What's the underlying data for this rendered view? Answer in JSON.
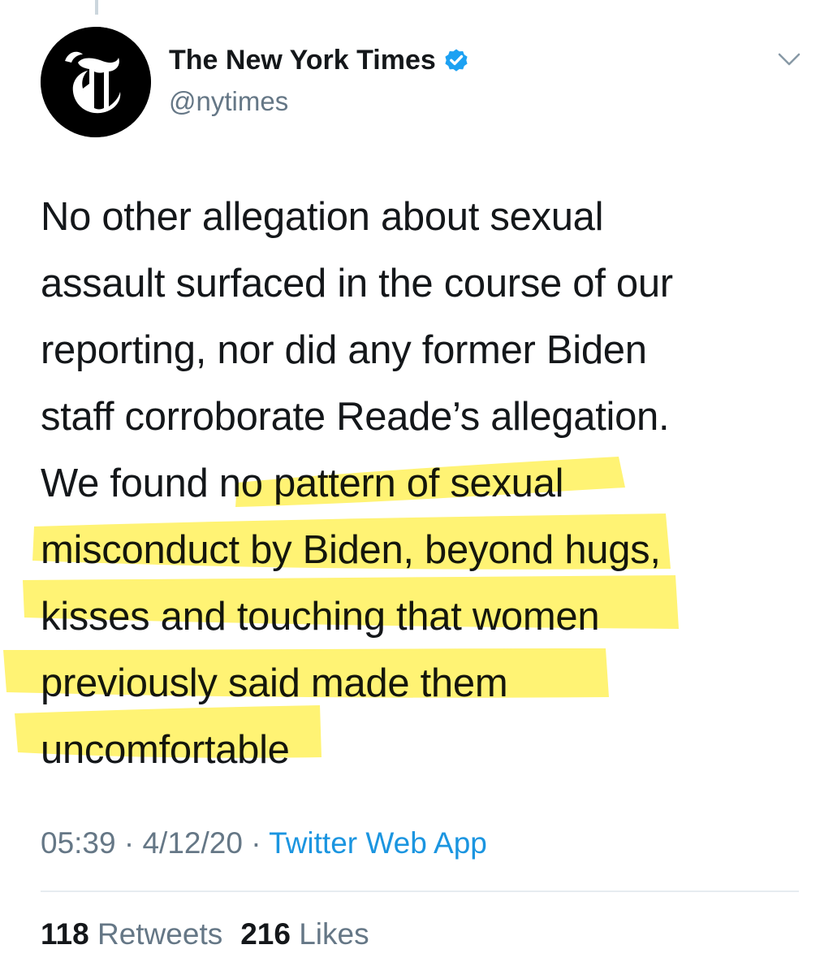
{
  "author": {
    "display_name": "The New York Times",
    "handle": "@nytimes",
    "verified": true,
    "avatar_icon": "nyt-t-logo-icon"
  },
  "menu_icon": "chevron-down-icon",
  "tweet": {
    "lines": [
      "No other allegation about sexual",
      "assault surfaced in the course of our",
      "reporting, nor did any former Biden",
      "staff corroborate Reade’s allegation.",
      "We found no pattern of sexual",
      "misconduct by Biden, beyond hugs,",
      "kisses and touching that women",
      "previously said made them",
      "uncomfortable"
    ],
    "highlighted_passage": "no pattern of sexual misconduct by Biden, beyond hugs, kisses and touching that women previously said made them uncomfortable",
    "highlight_color": "#fff04d"
  },
  "meta": {
    "time": "05:39",
    "date": "4/12/20",
    "separator": "·",
    "source": "Twitter Web App"
  },
  "stats": {
    "retweets_count": "118",
    "retweets_label": "Retweets",
    "likes_count": "216",
    "likes_label": "Likes"
  },
  "colors": {
    "text": "#14171a",
    "secondary_text": "#657786",
    "link": "#1b95e0",
    "verified_badge": "#1da1f2",
    "divider": "#e6ecf0"
  }
}
